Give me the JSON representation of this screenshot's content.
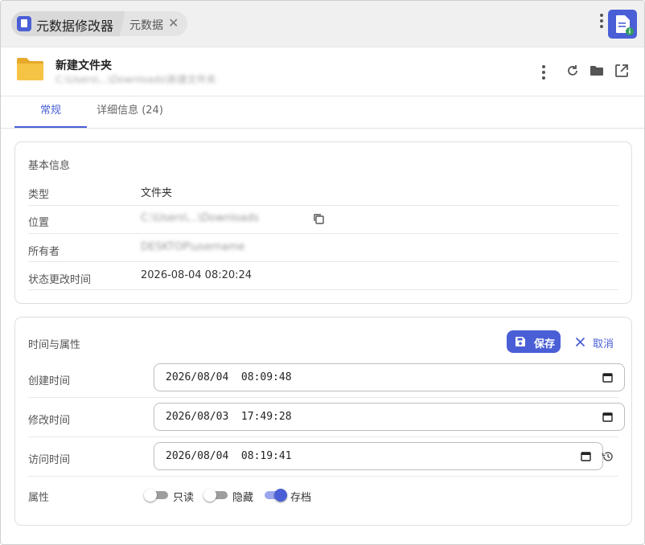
{
  "window": {
    "tab_title": "元数据修改器",
    "second_tab": "元数据",
    "close_glyph": "✕"
  },
  "header": {
    "file_name": "新建文件夹",
    "file_path": "C:\\Users\\...\\Downloads\\新建文件夹"
  },
  "tabs": [
    {
      "label": "常规",
      "active": true
    },
    {
      "label": "详细信息 (24)",
      "active": false
    }
  ],
  "basic_info": {
    "title": "基本信息",
    "rows": [
      {
        "label": "类型",
        "value": "文件夹"
      },
      {
        "label": "位置",
        "value": "C:\\Users\\...\\Downloads"
      },
      {
        "label": "所有者",
        "value": "DESKTOP\\username"
      },
      {
        "label": "状态更改时间",
        "value": "2026-08-04 08:20:24"
      }
    ]
  },
  "time_attrs": {
    "title": "时间与属性",
    "save_label": "保存",
    "cancel_label": "取消",
    "created_label": "创建时间",
    "created_value": "2026/08/04  08:09:48",
    "modified_label": "修改时间",
    "modified_value": "2026/08/03  17:49:28",
    "accessed_label": "访问时间",
    "accessed_value": "2026/08/04  08:19:41",
    "attributes_label": "属性",
    "attributes": [
      {
        "label": "只读",
        "on": false
      },
      {
        "label": "隐藏",
        "on": false
      },
      {
        "label": "存档",
        "on": true
      }
    ]
  },
  "colors": {
    "accent": "#4a5fd6",
    "folder": "#f6c445",
    "titlebar_bg": "#f0f0f0"
  },
  "icons": {
    "more": "kebab-icon",
    "refresh": "refresh-icon",
    "folder": "folder-icon",
    "open_external": "open-external-icon",
    "copy": "copy-icon",
    "calendar": "calendar-icon",
    "history": "history-icon",
    "save": "save-icon",
    "cancel": "close-icon"
  }
}
